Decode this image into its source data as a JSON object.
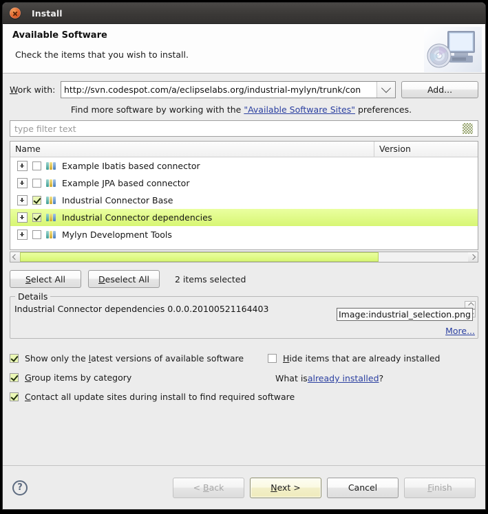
{
  "window": {
    "title": "Install",
    "close_icon": "close-icon"
  },
  "banner": {
    "heading": "Available Software",
    "subtitle": "Check the items that you wish to install.",
    "icon": "computer-disc-icon"
  },
  "work_with": {
    "label": "Work with:",
    "value": "http://svn.codespot.com/a/eclipselabs.org/industrial-mylyn/trunk/con",
    "dropdown_icon": "chevron-down-icon",
    "add_button": "Add..."
  },
  "hint": {
    "prefix": "Find more software by working with the ",
    "link": "\"Available Software Sites\"",
    "suffix": " preferences."
  },
  "filter": {
    "placeholder": "type filter text",
    "clear_icon": "eraser-icon"
  },
  "table": {
    "columns": [
      "Name",
      "Version"
    ],
    "rows": [
      {
        "name": "Example Ibatis based connector",
        "version": "",
        "checked": false,
        "selected": false
      },
      {
        "name": "Example JPA based connector",
        "version": "",
        "checked": false,
        "selected": false
      },
      {
        "name": "Industrial Connector Base",
        "version": "",
        "checked": true,
        "selected": false
      },
      {
        "name": "Industrial Connector dependencies",
        "version": "",
        "checked": true,
        "selected": true
      },
      {
        "name": "Mylyn Development Tools",
        "version": "",
        "checked": false,
        "selected": false
      }
    ]
  },
  "selection_bar": {
    "select_all": "Select All",
    "deselect_all": "Deselect All",
    "count_text": "2 items selected"
  },
  "details": {
    "legend": "Details",
    "text": "Industrial Connector dependencies 0.0.0.20100521164403",
    "more": "More...",
    "image_tooltip": "Image:industrial_selection.png"
  },
  "options": [
    {
      "label": "Show only the latest versions of available software",
      "checked": true,
      "mnemonic_index": 14
    },
    {
      "label": "Group items by category",
      "checked": true,
      "mnemonic_index": 0
    },
    {
      "label": "Contact all update sites during install to find required software",
      "checked": true,
      "mnemonic_index": 0
    }
  ],
  "options_right": {
    "hide_installed": {
      "label": "Hide items that are already installed",
      "checked": false
    },
    "what_is_prefix": "What is ",
    "what_is_link": "already installed",
    "what_is_suffix": "?"
  },
  "footer": {
    "help_icon": "question-mark-icon",
    "buttons": [
      {
        "label": "< Back",
        "state": "disabled"
      },
      {
        "label": "Next >",
        "state": "default"
      },
      {
        "label": "Cancel",
        "state": "normal"
      },
      {
        "label": "Finish",
        "state": "disabled"
      }
    ]
  },
  "colors": {
    "selection_highlight": "#d7f673",
    "link": "#2a3fa0",
    "titlebar": "#3b3937"
  }
}
